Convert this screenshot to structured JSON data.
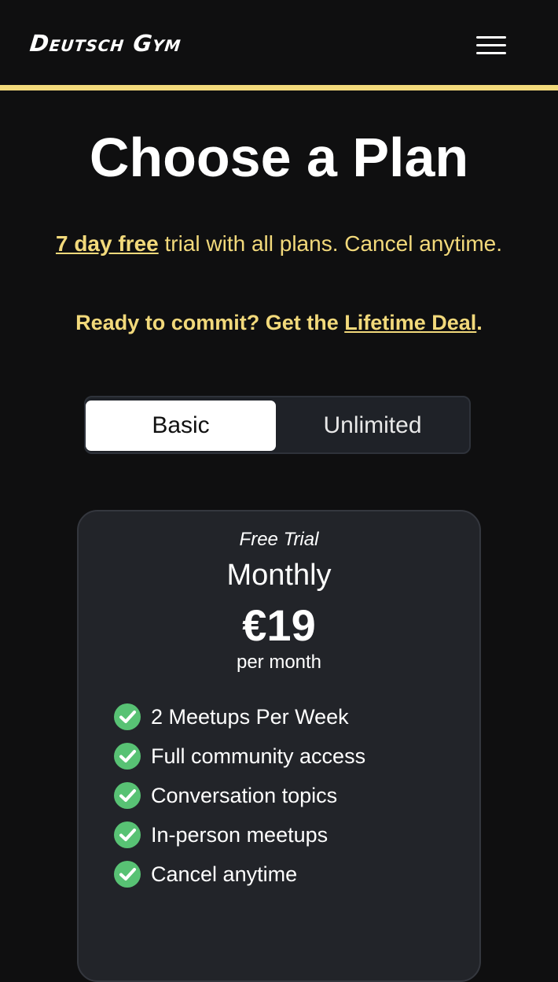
{
  "header": {
    "logo": "Deutsch Gym",
    "menu_icon": "hamburger-menu-icon",
    "accent_color": "#f2d97b"
  },
  "hero": {
    "title": "Choose a Plan",
    "trial_link": "7 day free",
    "trial_rest": " trial with all plans. Cancel anytime.",
    "commit_prefix": "Ready to commit? Get the ",
    "commit_link": "Lifetime Deal",
    "commit_suffix": "."
  },
  "plan_toggle": {
    "options": [
      "Basic",
      "Unlimited"
    ],
    "selected": "Basic"
  },
  "plan_card": {
    "badge": "Free Trial",
    "period": "Monthly",
    "price": "€19",
    "price_unit": "per month",
    "features": [
      "2 Meetups Per Week",
      "Full community access",
      "Conversation topics",
      "In-person meetups",
      "Cancel anytime"
    ],
    "check_color": "#58c274",
    "check_icon": "check-circle-icon"
  }
}
